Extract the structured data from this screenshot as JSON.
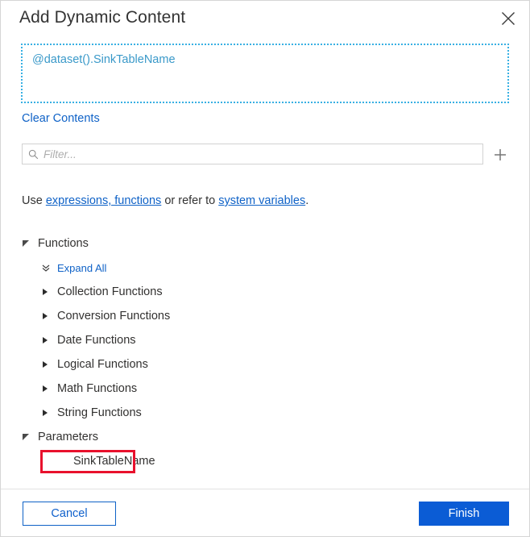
{
  "dialog": {
    "title": "Add Dynamic Content",
    "close_icon": "close-icon"
  },
  "expression": {
    "value": "@dataset().SinkTableName",
    "clear_label": "Clear Contents"
  },
  "filter": {
    "value": "",
    "placeholder": "Filter...",
    "search_icon": "search-icon",
    "add_icon": "plus-icon"
  },
  "help": {
    "prefix": "Use ",
    "link1": "expressions, functions",
    "middle": " or refer to ",
    "link2": "system variables",
    "suffix": "."
  },
  "tree": {
    "functions_group": "Functions",
    "expand_all": "Expand All",
    "items": [
      {
        "label": "Collection Functions"
      },
      {
        "label": "Conversion Functions"
      },
      {
        "label": "Date Functions"
      },
      {
        "label": "Logical Functions"
      },
      {
        "label": "Math Functions"
      },
      {
        "label": "String Functions"
      }
    ],
    "parameters_group": "Parameters",
    "parameters": [
      {
        "label": "SinkTableName"
      }
    ]
  },
  "footer": {
    "cancel_label": "Cancel",
    "finish_label": "Finish"
  },
  "colors": {
    "accent_blue": "#0b5cd5",
    "link_blue": "#0f62c7",
    "expression_text": "#3a99c9",
    "expression_border": "#38b0e3",
    "annotation_red": "#e8112d"
  }
}
